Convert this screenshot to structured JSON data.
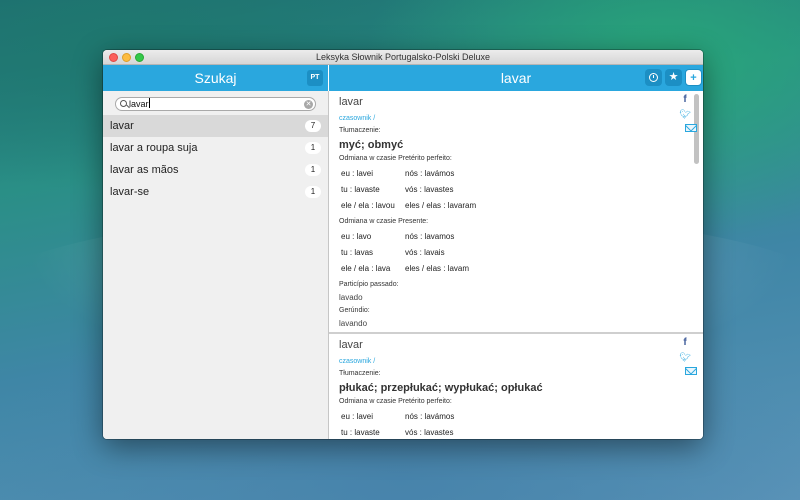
{
  "window": {
    "title": "Leksyka Słownik Portugalsko-Polski Deluxe"
  },
  "left_header": {
    "title": "Szukaj",
    "lang_badge": "PT"
  },
  "right_header": {
    "title": "lavar",
    "add_label": "+"
  },
  "search": {
    "value": "lavar"
  },
  "results": [
    {
      "label": "lavar",
      "count": "7"
    },
    {
      "label": "lavar a roupa suja",
      "count": "1"
    },
    {
      "label": "lavar as mãos",
      "count": "1"
    },
    {
      "label": "lavar-se",
      "count": "1"
    }
  ],
  "entries": [
    {
      "word": "lavar",
      "pos": "czasownik /",
      "translation_label": "Tłumaczenie:",
      "translation": "myć; obmyć",
      "conjugations": [
        {
          "label": "Odmiana w czasie Pretérito perfeito:",
          "rows": [
            [
              "eu : lavei",
              "nós : lavámos"
            ],
            [
              "tu : lavaste",
              "vós : lavastes"
            ],
            [
              "ele / ela : lavou",
              "eles / elas : lavaram"
            ]
          ]
        },
        {
          "label": "Odmiana w czasie Presente:",
          "rows": [
            [
              "eu : lavo",
              "nós : lavamos"
            ],
            [
              "tu : lavas",
              "vós : lavais"
            ],
            [
              "ele / ela : lava",
              "eles / elas : lavam"
            ]
          ]
        }
      ],
      "participle_label": "Particípio passado:",
      "participle": "lavado",
      "gerund_label": "Gerúndio:",
      "gerund": "lavando"
    },
    {
      "word": "lavar",
      "pos": "czasownik /",
      "translation_label": "Tłumaczenie:",
      "translation": "płukać; przepłukać; wypłukać; opłukać",
      "conjugations": [
        {
          "label": "Odmiana w czasie Pretérito perfeito:",
          "rows": [
            [
              "eu : lavei",
              "nós : lavámos"
            ],
            [
              "tu : lavaste",
              "vós : lavastes"
            ]
          ]
        }
      ]
    }
  ],
  "share_icons": [
    "facebook-icon",
    "twitter-icon",
    "mail-icon"
  ],
  "colors": {
    "accent": "#2aa7de",
    "accent_dark": "#1c8fc4",
    "selected_row": "#d9d9d9",
    "sidebar_bg": "#f0f0f0"
  }
}
